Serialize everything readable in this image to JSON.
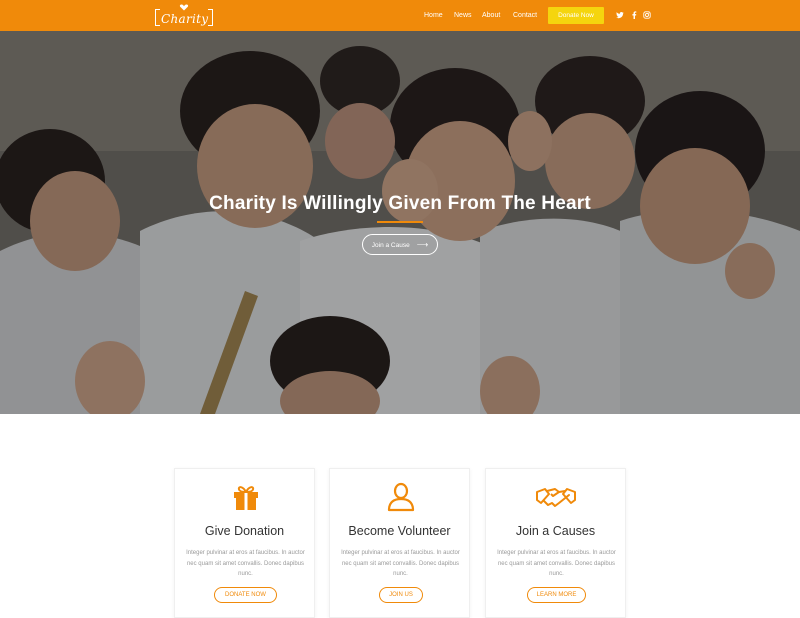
{
  "brand": {
    "name": "Charity",
    "accent": "#f08a0a",
    "button_yellow": "#f5d50e"
  },
  "nav": {
    "links": [
      {
        "label": "Home"
      },
      {
        "label": "News"
      },
      {
        "label": "About"
      },
      {
        "label": "Contact"
      }
    ],
    "donate_label": "Donate Now",
    "social": [
      "twitter-icon",
      "facebook-icon",
      "instagram-icon"
    ]
  },
  "hero": {
    "title": "Charity Is Willingly Given From The Heart",
    "button_label": "Join a Cause",
    "button_icon": "arrow-right-icon"
  },
  "cards": [
    {
      "icon": "gift-icon",
      "title": "Give Donation",
      "text": "Integer pulvinar at eros at faucibus. In auctor nec quam sit amet convallis. Donec dapibus nunc.",
      "button": "DONATE NOW"
    },
    {
      "icon": "user-icon",
      "title": "Become Volunteer",
      "text": "Integer pulvinar at eros at faucibus. In auctor nec quam sit amet convallis. Donec dapibus nunc.",
      "button": "JOIN US"
    },
    {
      "icon": "handshake-icon",
      "title": "Join a Causes",
      "text": "Integer pulvinar at eros at faucibus. In auctor nec quam sit amet convallis. Donec dapibus nunc.",
      "button": "LEARN MORE"
    }
  ]
}
